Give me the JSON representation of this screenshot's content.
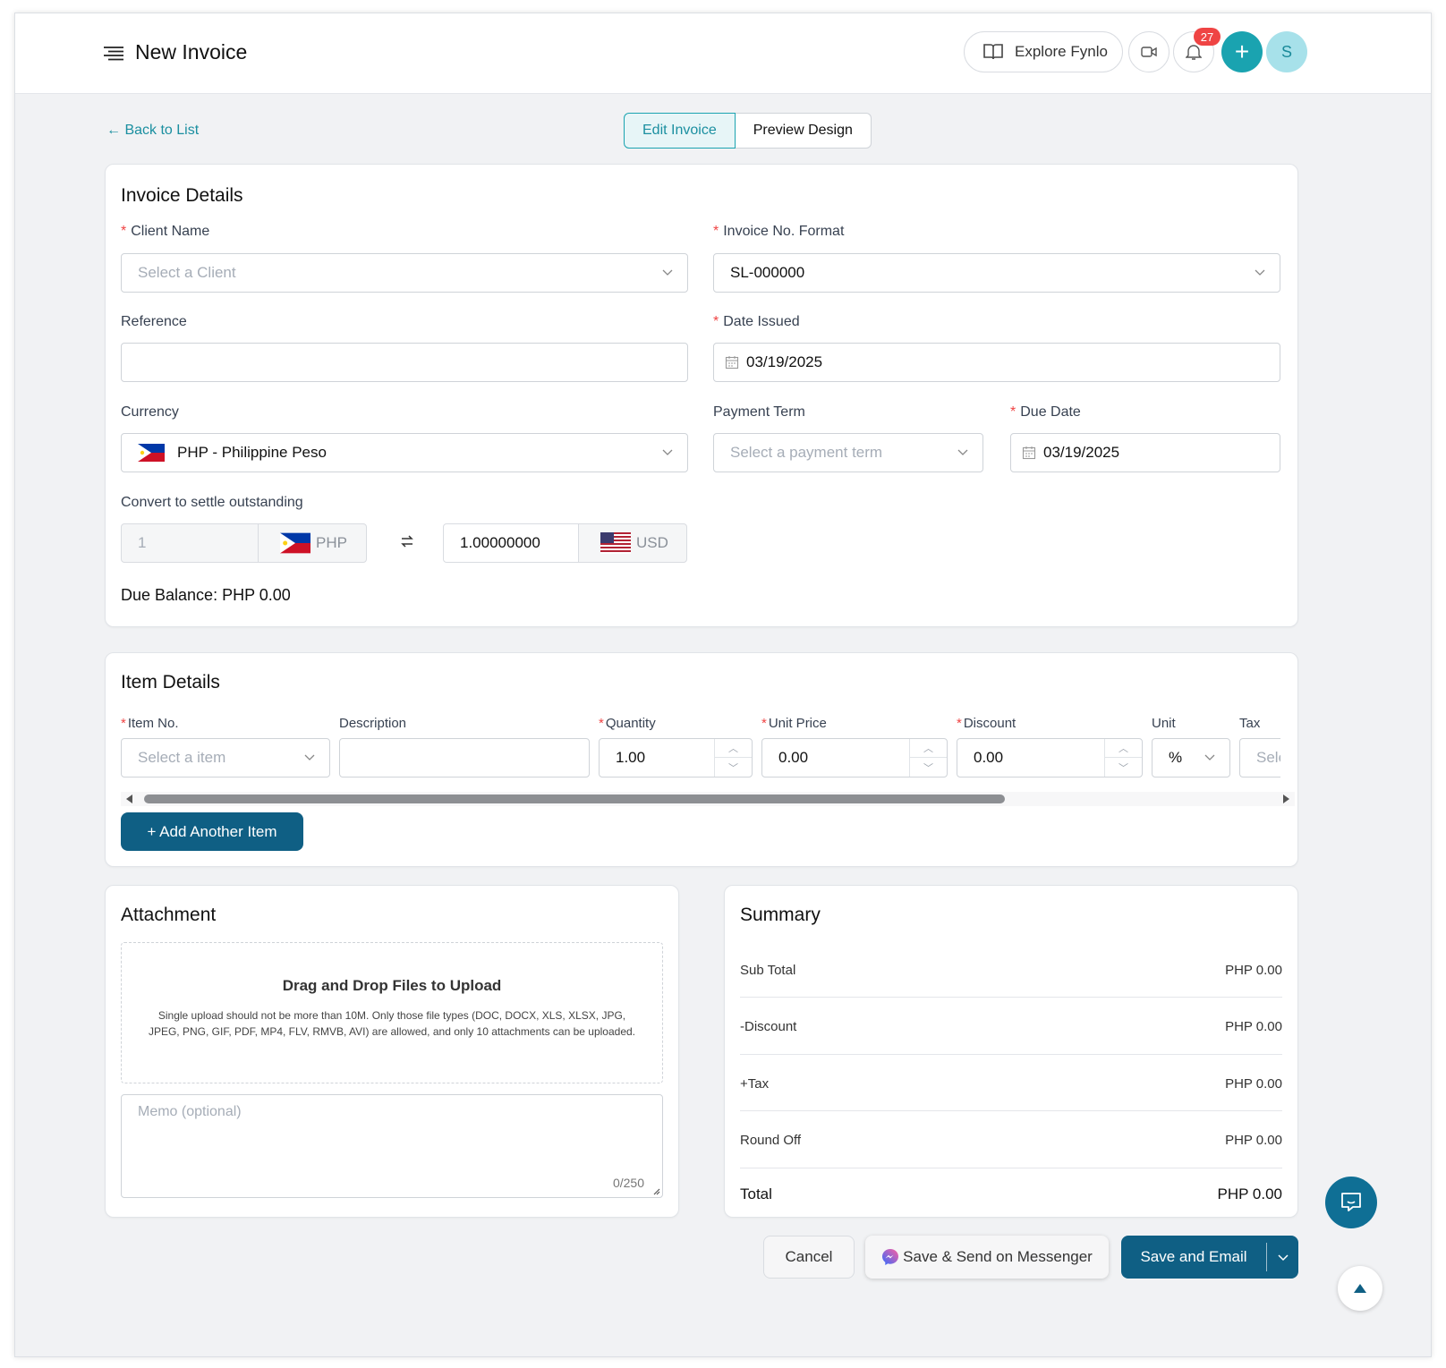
{
  "header": {
    "title": "New Invoice",
    "explore_label": "Explore Fynlo",
    "notification_count": "27",
    "avatar_initial": "S"
  },
  "nav": {
    "back_label": "← Back to List",
    "tabs": [
      {
        "label": "Edit Invoice",
        "active": true
      },
      {
        "label": "Preview Design",
        "active": false
      }
    ]
  },
  "invoice_details": {
    "title": "Invoice Details",
    "client_name": {
      "label": "Client Name",
      "required": true,
      "placeholder": "Select a Client"
    },
    "invoice_no_format": {
      "label": "Invoice No. Format",
      "required": true,
      "value": "SL-000000"
    },
    "reference": {
      "label": "Reference",
      "value": ""
    },
    "date_issued": {
      "label": "Date Issued",
      "required": true,
      "value": "03/19/2025"
    },
    "currency": {
      "label": "Currency",
      "value": "PHP - Philippine Peso"
    },
    "payment_term": {
      "label": "Payment Term",
      "placeholder": "Select a payment term"
    },
    "due_date": {
      "label": "Due Date",
      "required": true,
      "value": "03/19/2025"
    },
    "convert": {
      "label": "Convert to settle outstanding",
      "from_amount": "1",
      "from_currency": "PHP",
      "to_rate": "1.00000000",
      "to_currency": "USD"
    },
    "due_balance": "Due Balance: PHP 0.00"
  },
  "item_details": {
    "title": "Item Details",
    "columns": {
      "item_no": "Item No.",
      "description": "Description",
      "quantity": "Quantity",
      "unit_price": "Unit Price",
      "discount": "Discount",
      "unit": "Unit",
      "tax": "Tax"
    },
    "row": {
      "item_placeholder": "Select a item",
      "quantity": "1.00",
      "unit_price": "0.00",
      "discount": "0.00",
      "unit": "%",
      "tax_placeholder": "Sele"
    },
    "add_label": "+ Add Another Item"
  },
  "attachment": {
    "title": "Attachment",
    "drop_title": "Drag and Drop Files to Upload",
    "drop_text": "Single upload should not be more than 10M. Only those file types (DOC, DOCX, XLS, XLSX, JPG, JPEG, PNG, GIF, PDF, MP4, FLV, RMVB, AVI) are allowed, and only 10 attachments can be uploaded.",
    "memo_placeholder": "Memo (optional)",
    "memo_count": "0/250"
  },
  "summary": {
    "title": "Summary",
    "rows": [
      {
        "label": "Sub Total",
        "value": "PHP 0.00"
      },
      {
        "label": "-Discount",
        "value": "PHP 0.00"
      },
      {
        "label": "+Tax",
        "value": "PHP 0.00"
      },
      {
        "label": "Round Off",
        "value": "PHP 0.00"
      },
      {
        "label": "Total",
        "value": "PHP 0.00"
      }
    ]
  },
  "actions": {
    "cancel": "Cancel",
    "messenger": "Save & Send on Messenger",
    "save_email": "Save and Email"
  },
  "colors": {
    "primary": "#0f5f84",
    "accent": "#1aa3b0",
    "required": "#ef4444"
  }
}
